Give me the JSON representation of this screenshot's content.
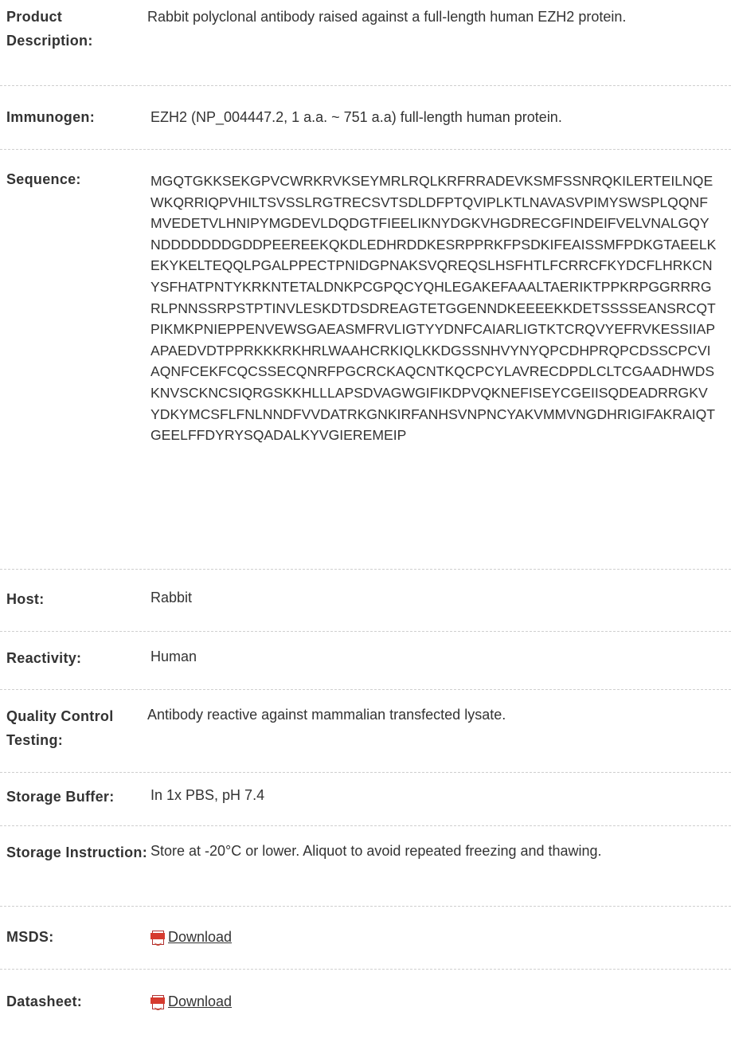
{
  "rows": [
    {
      "label": "Product Description:",
      "value": "Rabbit polyclonal antibody raised against a full-length human EZH2 protein."
    },
    {
      "label": "Immunogen:",
      "value": "EZH2 (NP_004447.2, 1 a.a. ~ 751 a.a) full-length human protein."
    },
    {
      "label": "Sequence:",
      "value": "MGQTGKKSEKGPVCWRKRVKSEYMRLRQLKRFRRADEVKSMFSSNRQKILERTEILNQEWKQRRIQPVHILTSVSSLRGTRECSVTSDLDFPTQVIPLKTLNAVASVPIMYSWSPLQQNFMVEDETVLHNIPYMGDEVLDQDGTFIEELIKNYDGKVHGDRECGFINDEIFVELVNALGQYNDDDDDDDGDDPEEREEKQKDLEDHRDDKESRPPRKFPSDKIFEAISSMFPDKGTAEELKEKYKELTEQQLPGALPPECTPNIDGPNAKSVQREQSLHSFHTLFCRRCFKYDCFLHRKCNYSFHATPNTYKRKNTETALDNKPCGPQCYQHLEGAKEFAAALTAERIKTPPKRPGGRRRGRLPNNSSRPSTPTINVLESKDTDSDREAGTETGGENNDKEEEEKKDETSSSSEANSRCQTPIKMKPNIEPPENVEWSGAEASMFRVLIGTYYDNFCAIARLIGTKTCRQVYEFRVKESSIIAPAPAEDVDTPPRKKKRKHRLWAAHCRKIQLKKDGSSNHVYNYQPCDHPRQPCDSSCPCVIAQNFCEKFCQCSSECQNRFPGCRCKAQCNTKQCPCYLAVRECDPDLCLTCGAADHWDSKNVSCKNCSIQRGSKKHLLLAPSDVAGWGIFIKDPVQKNEFISEYCGEIISQDEADRRGKVYDKYMCSFLFNLNNDFVVDATRKGNKIRFANHSVNPNCYAKVMMVNGDHRIGIFAKRAIQTGEELFFDYRYSQADALKYVGIEREMEIP"
    },
    {
      "label": "Host:",
      "value": "Rabbit"
    },
    {
      "label": "Reactivity:",
      "value": "Human"
    },
    {
      "label": "Quality Control Testing:",
      "value": "Antibody reactive against mammalian transfected lysate."
    },
    {
      "label": "Storage Buffer:",
      "value": "In 1x PBS, pH 7.4"
    },
    {
      "label": "Storage Instruction:",
      "value": "Store at -20°C or lower. Aliquot to avoid repeated freezing and thawing."
    },
    {
      "label": "MSDS:",
      "value": "Download",
      "icon": "pdf-icon"
    },
    {
      "label": "Datasheet:",
      "value": "Download",
      "icon": "pdf-icon"
    }
  ]
}
